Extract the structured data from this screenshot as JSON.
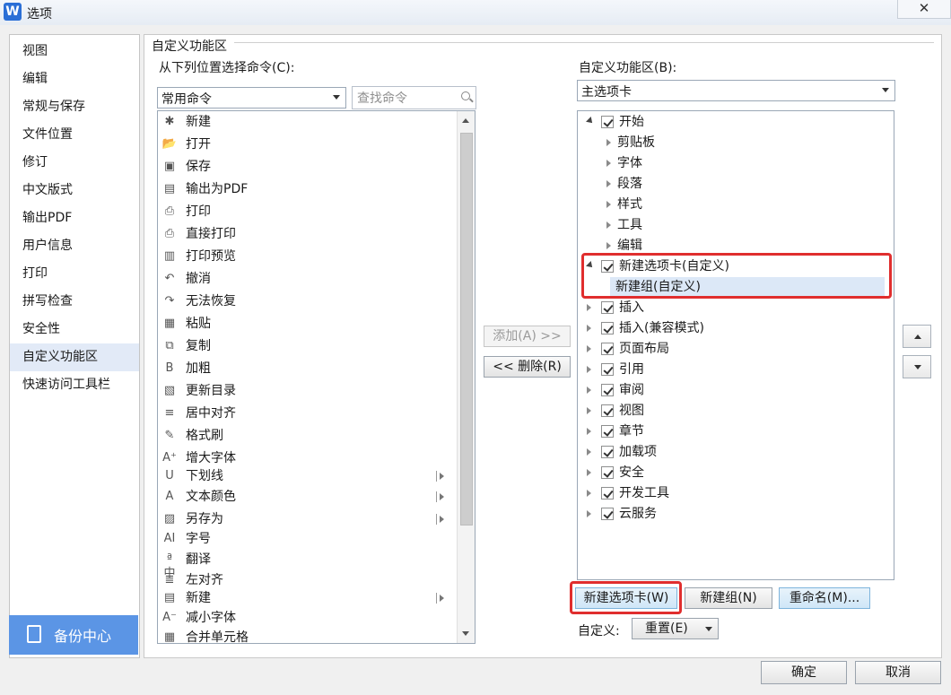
{
  "window": {
    "title": "选项",
    "app_icon_letter": "W",
    "close_glyph": "✕"
  },
  "nav": {
    "items": [
      "视图",
      "编辑",
      "常规与保存",
      "文件位置",
      "修订",
      "中文版式",
      "输出PDF",
      "用户信息",
      "打印",
      "拼写检查",
      "安全性",
      "自定义功能区",
      "快速访问工具栏"
    ],
    "active_index": 11,
    "backup_label": "备份中心"
  },
  "panel": {
    "group_title": "自定义功能区",
    "left_label": "从下列位置选择命令(C):",
    "left_combo_value": "常用命令",
    "search_placeholder": "查找命令",
    "right_label": "自定义功能区(B):",
    "right_combo_value": "主选项卡"
  },
  "commands": [
    {
      "label": "新建",
      "icon": "new-doc-icon",
      "glyph": "✱"
    },
    {
      "label": "打开",
      "icon": "open-folder-icon",
      "glyph": "📂"
    },
    {
      "label": "保存",
      "icon": "save-icon",
      "glyph": "▣"
    },
    {
      "label": "输出为PDF",
      "icon": "pdf-export-icon",
      "glyph": "▤"
    },
    {
      "label": "打印",
      "icon": "printer-icon",
      "glyph": "⎙"
    },
    {
      "label": "直接打印",
      "icon": "direct-print-icon",
      "glyph": "⎙"
    },
    {
      "label": "打印预览",
      "icon": "print-preview-icon",
      "glyph": "▥"
    },
    {
      "label": "撤消",
      "icon": "undo-icon",
      "glyph": "↶"
    },
    {
      "label": "无法恢复",
      "icon": "redo-icon",
      "glyph": "↷"
    },
    {
      "label": "粘贴",
      "icon": "paste-icon",
      "glyph": "▦"
    },
    {
      "label": "复制",
      "icon": "copy-icon",
      "glyph": "⧉"
    },
    {
      "label": "加粗",
      "icon": "bold-icon",
      "glyph": "B"
    },
    {
      "label": "更新目录",
      "icon": "update-toc-icon",
      "glyph": "▧"
    },
    {
      "label": "居中对齐",
      "icon": "align-center-icon",
      "glyph": "≡"
    },
    {
      "label": "格式刷",
      "icon": "format-painter-icon",
      "glyph": "✎"
    },
    {
      "label": "增大字体",
      "icon": "font-increase-icon",
      "glyph": "A⁺"
    },
    {
      "label": "下划线",
      "icon": "underline-icon",
      "glyph": "U"
    },
    {
      "label": "文本颜色",
      "icon": "text-color-icon",
      "glyph": "A"
    },
    {
      "label": "另存为",
      "icon": "save-as-icon",
      "glyph": "▨"
    },
    {
      "label": "字号",
      "icon": "font-size-icon",
      "glyph": "AI"
    },
    {
      "label": "翻译",
      "icon": "translate-icon",
      "glyph": "ª中"
    },
    {
      "label": "左对齐",
      "icon": "align-left-icon",
      "glyph": "≣"
    },
    {
      "label": "新建",
      "icon": "new-doc-icon",
      "glyph": "▤"
    },
    {
      "label": "减小字体",
      "icon": "font-decrease-icon",
      "glyph": "A⁻"
    },
    {
      "label": "合并单元格",
      "icon": "merge-cells-icon",
      "glyph": "▦"
    }
  ],
  "buttons": {
    "add": "添加(A) >>",
    "remove": "<< 删除(R)",
    "new_tab": "新建选项卡(W)",
    "new_group": "新建组(N)",
    "rename": "重命名(M)...",
    "customize_label": "自定义:",
    "reset": "重置(E)",
    "ok": "确定",
    "cancel": "取消"
  },
  "tree": [
    {
      "label": "开始",
      "level": 0,
      "expanded": true,
      "checked": true
    },
    {
      "label": "剪贴板",
      "level": 1
    },
    {
      "label": "字体",
      "level": 1
    },
    {
      "label": "段落",
      "level": 1
    },
    {
      "label": "样式",
      "level": 1
    },
    {
      "label": "工具",
      "level": 1
    },
    {
      "label": "编辑",
      "level": 1
    },
    {
      "label": "新建选项卡(自定义)",
      "level": 0,
      "expanded": true,
      "checked": true
    },
    {
      "label": "新建组(自定义)",
      "level": 1,
      "selected": true
    },
    {
      "label": "插入",
      "level": 0,
      "checked": true
    },
    {
      "label": "插入(兼容模式)",
      "level": 0,
      "checked": true
    },
    {
      "label": "页面布局",
      "level": 0,
      "checked": true
    },
    {
      "label": "引用",
      "level": 0,
      "checked": true
    },
    {
      "label": "审阅",
      "level": 0,
      "checked": true
    },
    {
      "label": "视图",
      "level": 0,
      "checked": true
    },
    {
      "label": "章节",
      "level": 0,
      "checked": true
    },
    {
      "label": "加载项",
      "level": 0,
      "checked": true
    },
    {
      "label": "安全",
      "level": 0,
      "checked": true
    },
    {
      "label": "开发工具",
      "level": 0,
      "checked": true
    },
    {
      "label": "云服务",
      "level": 0,
      "checked": true
    }
  ],
  "colors": {
    "highlight": "#e02e2e",
    "accent": "#5b95e5",
    "selection": "#dce8f7"
  }
}
